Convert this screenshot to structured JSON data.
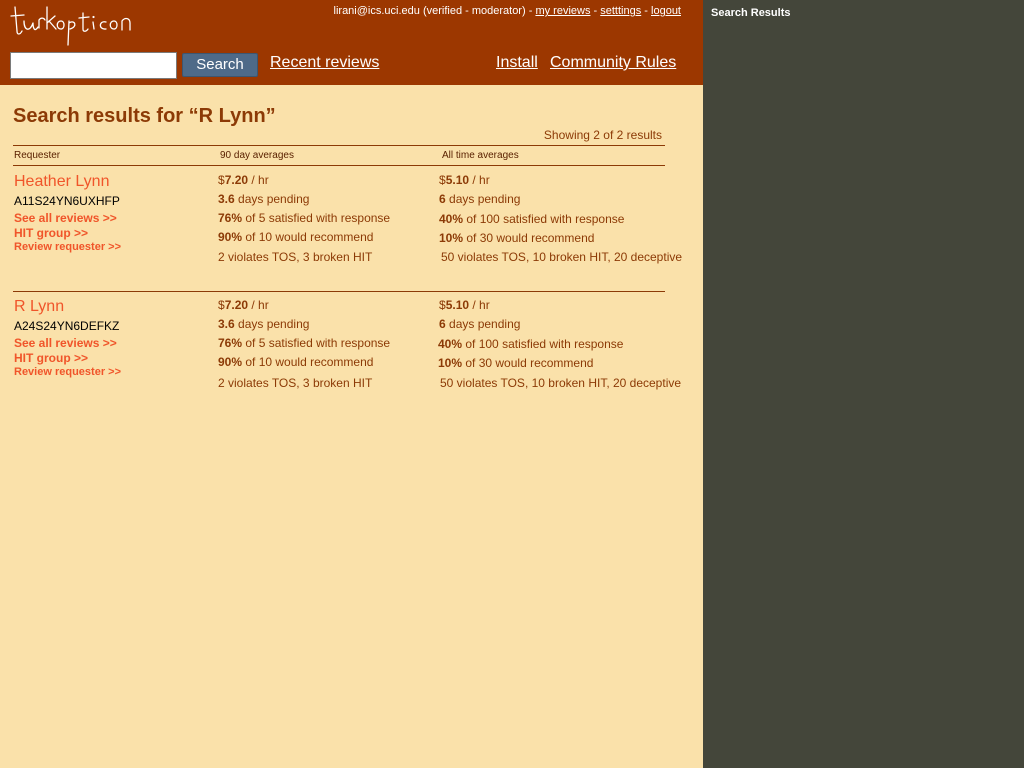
{
  "header": {
    "logo_text": "turkopticon",
    "user": "lirani@ics.uci.edu (verified - moderator)",
    "sep": " - ",
    "my_reviews": "my reviews",
    "settings": "setttings",
    "logout": "logout",
    "search_placeholder": "",
    "search_button": "Search",
    "recent_reviews": "Recent reviews",
    "install": "Install",
    "community_rules": "Community Rules"
  },
  "results": {
    "title": "Search results for “R Lynn”",
    "showing": "Showing 2 of 2 results",
    "col_requester": "Requester",
    "col_90day": "90 day averages",
    "col_alltime": "All time averages",
    "items": [
      {
        "name": "Heather Lynn",
        "id": "A11S24YN6UXHFP",
        "see_all": "See all reviews >>",
        "hit_group": "HIT group >>",
        "review": "Review requester >>",
        "d90": {
          "pay_prefix": "$",
          "pay_value": "7.20",
          "pay_suffix": " / hr",
          "pending_value": "3.6",
          "pending_label": " days pending",
          "satisfied_value": "76%",
          "satisfied_label": " of 5 satisfied with response",
          "recommend_value": "90%",
          "recommend_label": " of 10 would recommend",
          "violations": "2 violates TOS, 3 broken HIT"
        },
        "all": {
          "pay_prefix": "$",
          "pay_value": "5.10",
          "pay_suffix": " / hr",
          "pending_value": "6",
          "pending_label": " days pending",
          "satisfied_value": "40%",
          "satisfied_label": " of 100 satisfied with response",
          "recommend_value": "10%",
          "recommend_label": " of 30 would recommend",
          "violations": "50 violates TOS, 10 broken HIT, 20 deceptive"
        }
      },
      {
        "name": "R Lynn",
        "id": "A24S24YN6DEFKZ",
        "see_all": "See all reviews >>",
        "hit_group": "HIT group >>",
        "review": "Review requester >>",
        "d90": {
          "pay_prefix": "$",
          "pay_value": "7.20",
          "pay_suffix": " / hr",
          "pending_value": "3.6",
          "pending_label": " days pending",
          "satisfied_value": "76%",
          "satisfied_label": " of 5 satisfied with response",
          "recommend_value": "90%",
          "recommend_label": " of 10 would recommend",
          "violations": "2 violates TOS, 3 broken HIT"
        },
        "all": {
          "pay_prefix": "$",
          "pay_value": "5.10",
          "pay_suffix": " / hr",
          "pending_value": "6",
          "pending_label": " days pending",
          "satisfied_value": "40%",
          "satisfied_label": " of 100 satisfied with response",
          "recommend_value": "10%",
          "recommend_label": " of 30 would recommend",
          "violations": "50 violates TOS, 10 broken HIT, 20 deceptive"
        }
      }
    ]
  },
  "sidebar": {
    "title": "Search Results"
  },
  "colors": {
    "header_bg": "#9c3700",
    "page_bg": "#fae1aa",
    "side_bg": "#44463a",
    "title_brown": "#8c3a06",
    "link_orange": "#f0552a",
    "button_blue": "#4e6a88"
  }
}
